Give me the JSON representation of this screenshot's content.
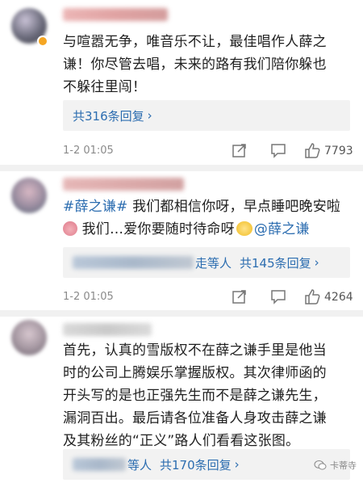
{
  "comments": [
    {
      "body_line1": "与喧嚣无争，唯音乐不让，最佳唱作人薛之",
      "body_line2": "谦！你尽管去唱，未来的路有我们陪你躲也",
      "body_line3": "不躲往里闯！",
      "reply_summary": "共316条回复",
      "time": "1-2 01:05",
      "like_count": "7793"
    },
    {
      "topic": "#薛之谦#",
      "body_line1_rest": " 我们都相信你呀，早点睡吧晚安啦",
      "body_line2_a": " 我们…爱你要随时待命呀",
      "mention": "@薛之谦",
      "reply_names_suffix": "走等人",
      "reply_summary": "共145条回复",
      "time": "1-2 01:05",
      "like_count": "4264"
    },
    {
      "body_line1": "首先，认真的雪版权不在薛之谦手里是他当",
      "body_line2": "时的公司上腾娱乐掌握版权。其次律师函的",
      "body_line3": "开头写的是也正强先生而不是薛之谦先生，",
      "body_line4": "漏洞百出。最后请各位准备人身攻击薛之谦",
      "body_line5": "及其粉丝的“正义”路人们看看这张图。",
      "reply_names_suffix": "等人",
      "reply_summary": "共170条回复"
    }
  ],
  "watermark": {
    "text": "卡蒂寺"
  },
  "icons": {
    "share": "share-icon",
    "comment": "comment-icon",
    "like": "thumbs-up-icon",
    "chevron": "chevron-right-icon"
  },
  "colors": {
    "link": "#2c6db0",
    "badge": "#f5a623"
  }
}
